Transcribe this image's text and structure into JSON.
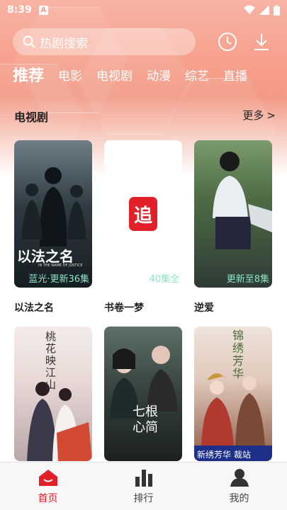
{
  "status_bar": {
    "time": "8:39",
    "notif": "A"
  },
  "search": {
    "placeholder": "热剧搜索"
  },
  "header": {
    "history_icon": "clock-icon",
    "download_icon": "download-icon"
  },
  "categories": [
    "推荐",
    "电影",
    "电视剧",
    "动漫",
    "综艺",
    "直播"
  ],
  "section": {
    "title": "电视剧",
    "more": "更多"
  },
  "row1": [
    {
      "name": "以法之名",
      "badge": "蓝光·更新36集",
      "poster_text": "以法之名",
      "poster_sub": "IN THE NAME OF JUSTICE"
    },
    {
      "name": "书卷一梦",
      "badge": "40集全",
      "logo": "追"
    },
    {
      "name": "逆爱",
      "badge": "更新至8集"
    }
  ],
  "row2": [
    {
      "poster_text": "桃花映江山"
    },
    {
      "poster_text": "七根心简"
    },
    {
      "poster_text": "锦绣芳华",
      "poster_banner": "新绣芳华 裁站"
    }
  ],
  "tabs": [
    {
      "label": "首页",
      "icon": "home-icon"
    },
    {
      "label": "排行",
      "icon": "ranking-icon"
    },
    {
      "label": "我的",
      "icon": "profile-icon"
    }
  ],
  "colors": {
    "accent": "#e2202a",
    "header_bg": "#f39a86",
    "badge": "#8ee3c7"
  }
}
